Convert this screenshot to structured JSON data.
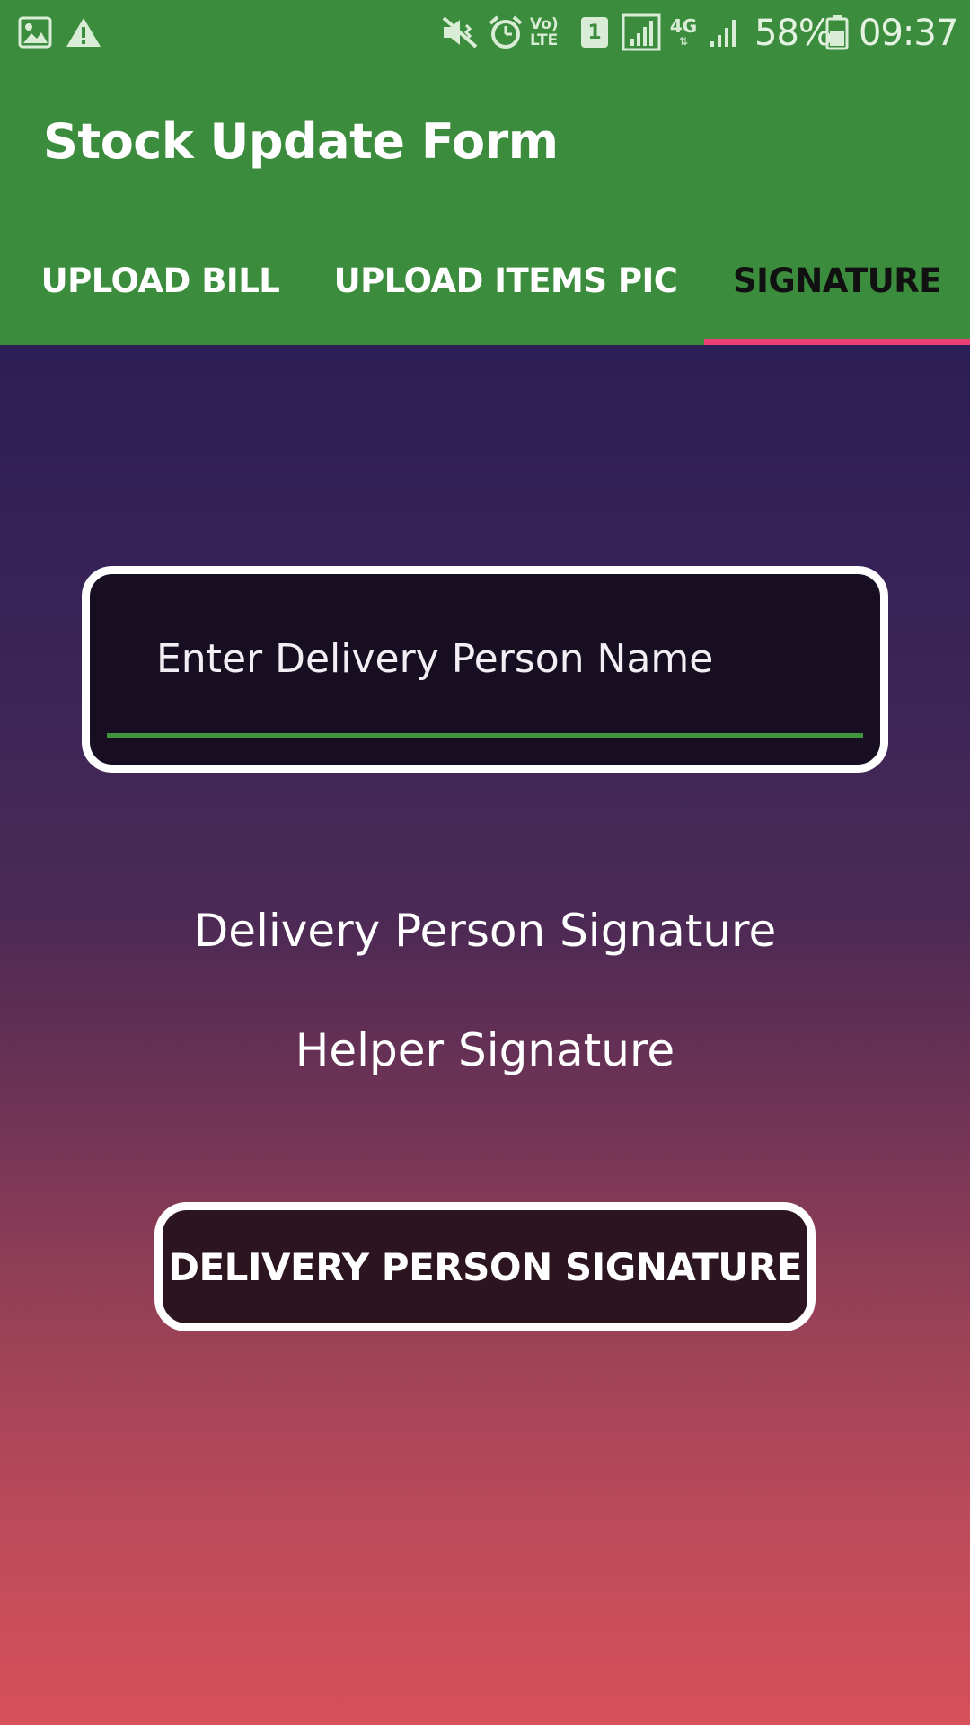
{
  "status_bar": {
    "icons": [
      "image-icon",
      "warning-icon",
      "mute-icon",
      "alarm-icon",
      "volte-icon",
      "sim-1-icon",
      "signal-icon",
      "4g-icon",
      "signal-weak-icon",
      "battery-icon"
    ],
    "volte_label": "Vo) LTE",
    "sim_label": "1",
    "network_label": "4G",
    "battery": "58%",
    "time": "09:37"
  },
  "appbar": {
    "title": "Stock Update Form"
  },
  "tabs": [
    {
      "label": "UPLOAD BILL",
      "active": false
    },
    {
      "label": "UPLOAD ITEMS PIC",
      "active": false
    },
    {
      "label": "SIGNATURE",
      "active": true
    }
  ],
  "colors": {
    "primary": "#3c8c3e",
    "tab_indicator": "#ec3f78",
    "gradient_top": "#2c1e56",
    "gradient_bottom": "#d6515b",
    "field_underline": "#43943f"
  },
  "form": {
    "name_field": {
      "placeholder": "Enter Delivery Person Name",
      "value": ""
    },
    "delivery_signature_label": "Delivery Person Signature",
    "helper_signature_label": "Helper Signature",
    "signature_button_label": "DELIVERY PERSON SIGNATURE"
  }
}
